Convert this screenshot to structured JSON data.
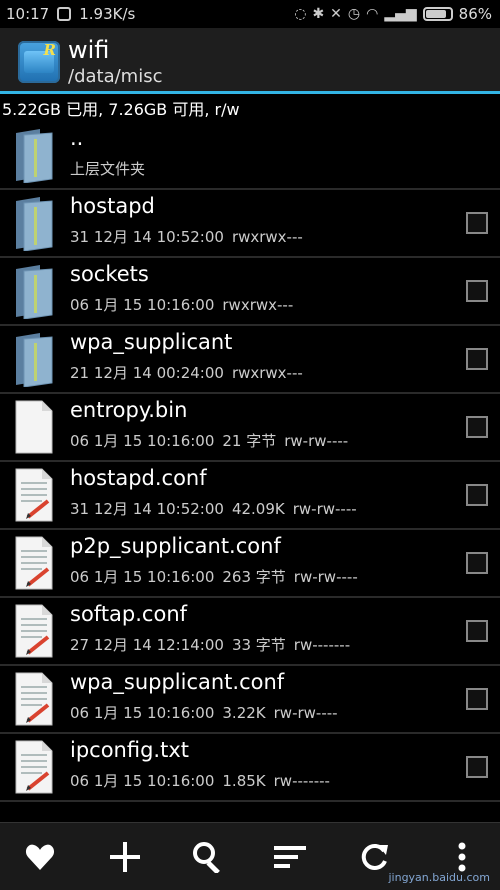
{
  "status": {
    "time": "10:17",
    "speed": "1.93K/s",
    "battery": "86%",
    "battery_level": 0.86
  },
  "header": {
    "title": "wifi",
    "path": "/data/misc",
    "app_icon_letter": "R"
  },
  "storage_info": "5.22GB 已用, 7.26GB 可用, r/w",
  "files": [
    {
      "name": "..",
      "date": "上层文件夹",
      "size": "",
      "perm": "",
      "type": "folder",
      "checkbox": false
    },
    {
      "name": "hostapd",
      "date": "31 12月 14 10:52:00",
      "size": "",
      "perm": "rwxrwx---",
      "type": "folder",
      "checkbox": true
    },
    {
      "name": "sockets",
      "date": "06 1月 15 10:16:00",
      "size": "",
      "perm": "rwxrwx---",
      "type": "folder",
      "checkbox": true
    },
    {
      "name": "wpa_supplicant",
      "date": "21 12月 14 00:24:00",
      "size": "",
      "perm": "rwxrwx---",
      "type": "folder",
      "checkbox": true
    },
    {
      "name": "entropy.bin",
      "date": "06 1月 15 10:16:00",
      "size": "21 字节",
      "perm": "rw-rw----",
      "type": "file",
      "checkbox": true
    },
    {
      "name": "hostapd.conf",
      "date": "31 12月 14 10:52:00",
      "size": "42.09K",
      "perm": "rw-rw----",
      "type": "text",
      "checkbox": true
    },
    {
      "name": "p2p_supplicant.conf",
      "date": "06 1月 15 10:16:00",
      "size": "263 字节",
      "perm": "rw-rw----",
      "type": "text",
      "checkbox": true
    },
    {
      "name": "softap.conf",
      "date": "27 12月 14 12:14:00",
      "size": "33 字节",
      "perm": "rw-------",
      "type": "text",
      "checkbox": true
    },
    {
      "name": "wpa_supplicant.conf",
      "date": "06 1月 15 10:16:00",
      "size": "3.22K",
      "perm": "rw-rw----",
      "type": "text",
      "checkbox": true
    },
    {
      "name": "ipconfig.txt",
      "date": "06 1月 15 10:16:00",
      "size": "1.85K",
      "perm": "rw-------",
      "type": "text",
      "checkbox": true
    }
  ],
  "bottom_bar": {
    "buttons": [
      "heart-icon",
      "add-icon",
      "search-icon",
      "sort-icon",
      "refresh-icon",
      "more-icon"
    ]
  },
  "watermark": "jingyan.baidu.com"
}
